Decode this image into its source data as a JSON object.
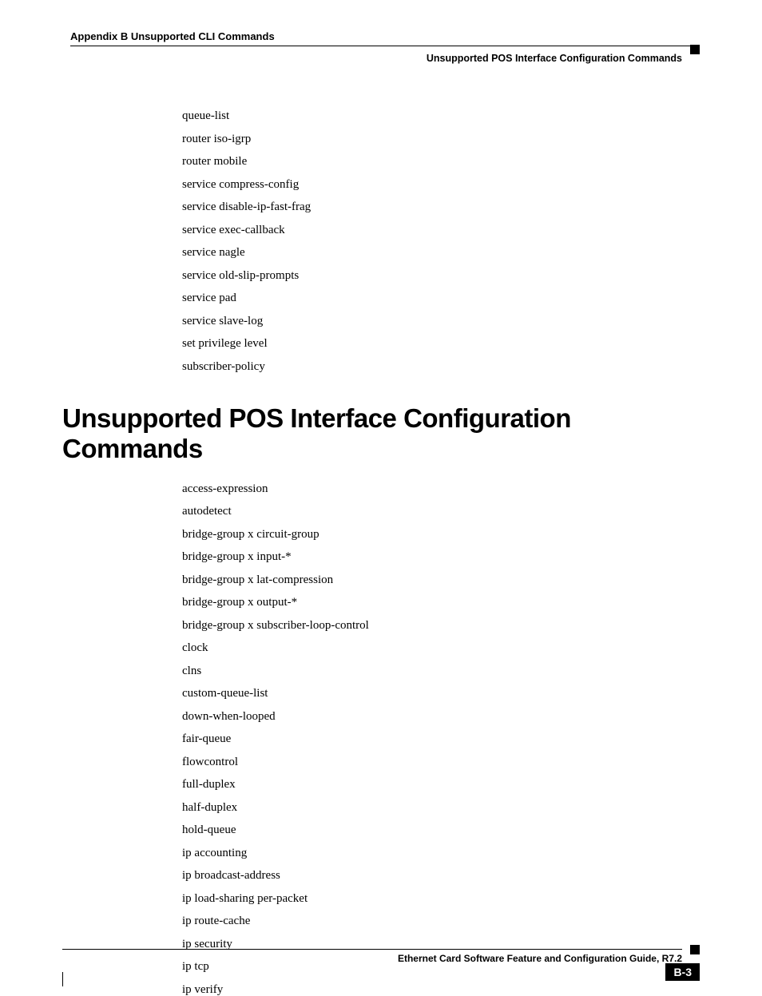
{
  "header": {
    "left": "Appendix B  Unsupported CLI Commands",
    "right": "Unsupported POS Interface Configuration Commands"
  },
  "list1": [
    "queue-list",
    "router iso-igrp",
    "router mobile",
    "service compress-config",
    "service disable-ip-fast-frag",
    "service exec-callback",
    "service nagle",
    "service old-slip-prompts",
    "service pad",
    "service slave-log",
    "set privilege level",
    "subscriber-policy"
  ],
  "section_heading": "Unsupported POS Interface Configuration Commands",
  "list2": [
    "access-expression",
    "autodetect",
    "bridge-group x circuit-group",
    "bridge-group x input-*",
    "bridge-group x lat-compression",
    "bridge-group x output-*",
    "bridge-group x subscriber-loop-control",
    "clock",
    "clns",
    "custom-queue-list",
    "down-when-looped",
    "fair-queue",
    "flowcontrol",
    "full-duplex",
    "half-duplex",
    "hold-queue",
    "ip accounting",
    "ip broadcast-address",
    "ip load-sharing per-packet",
    "ip route-cache",
    "ip security",
    "ip tcp",
    "ip verify"
  ],
  "footer": {
    "title": "Ethernet Card Software Feature and Configuration Guide, R7.2",
    "page": "B-3"
  }
}
